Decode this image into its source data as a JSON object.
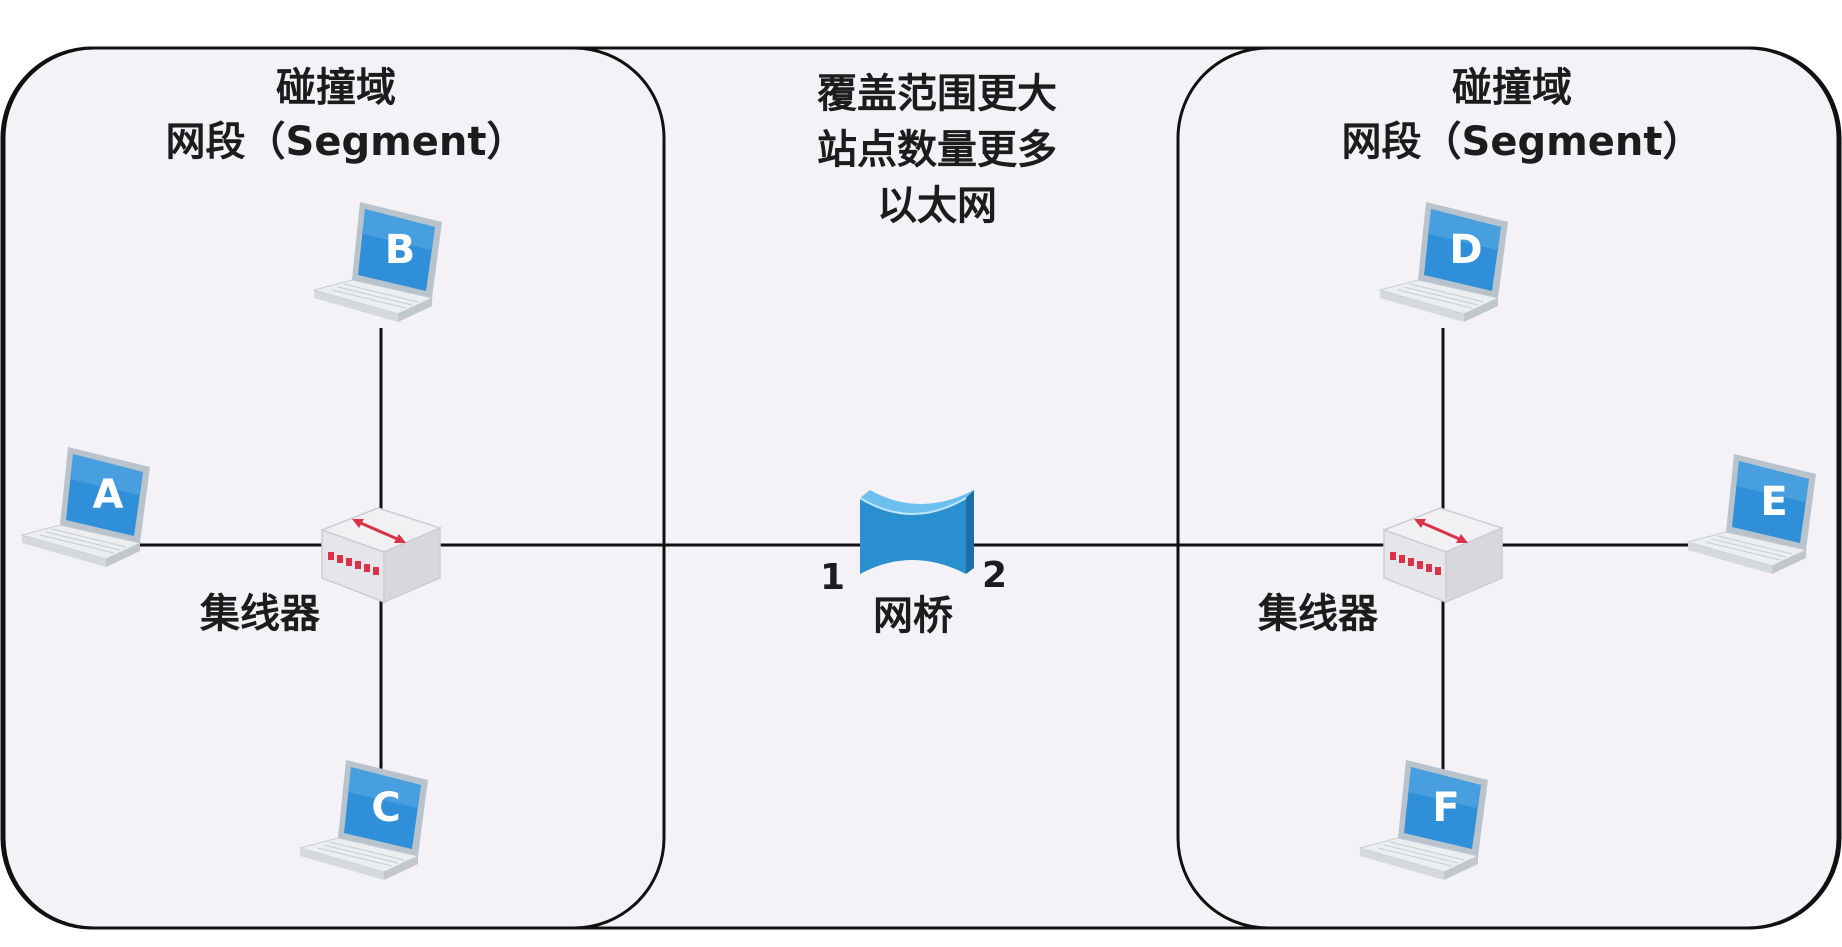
{
  "segment_left": {
    "title_line1": "碰撞域",
    "title_line2": "网段（Segment）",
    "hub_label": "集线器",
    "hosts": [
      "A",
      "B",
      "C"
    ]
  },
  "segment_right": {
    "title_line1": "碰撞域",
    "title_line2": "网段（Segment）",
    "hub_label": "集线器",
    "hosts": [
      "D",
      "E",
      "F"
    ]
  },
  "center": {
    "line1": "覆盖范围更大",
    "line2": "站点数量更多",
    "line3": "以太网"
  },
  "bridge": {
    "label": "网桥",
    "port1": "1",
    "port2": "2"
  },
  "icons": {
    "host": "laptop-icon",
    "hub": "hub-icon",
    "bridge": "bridge-icon"
  },
  "colors": {
    "laptop_screen": "#2f8fd8",
    "bridge": "#2a8fce",
    "hub_arrow": "#d9334a",
    "panel_bg": "#f4f2f6",
    "line": "#111111"
  }
}
